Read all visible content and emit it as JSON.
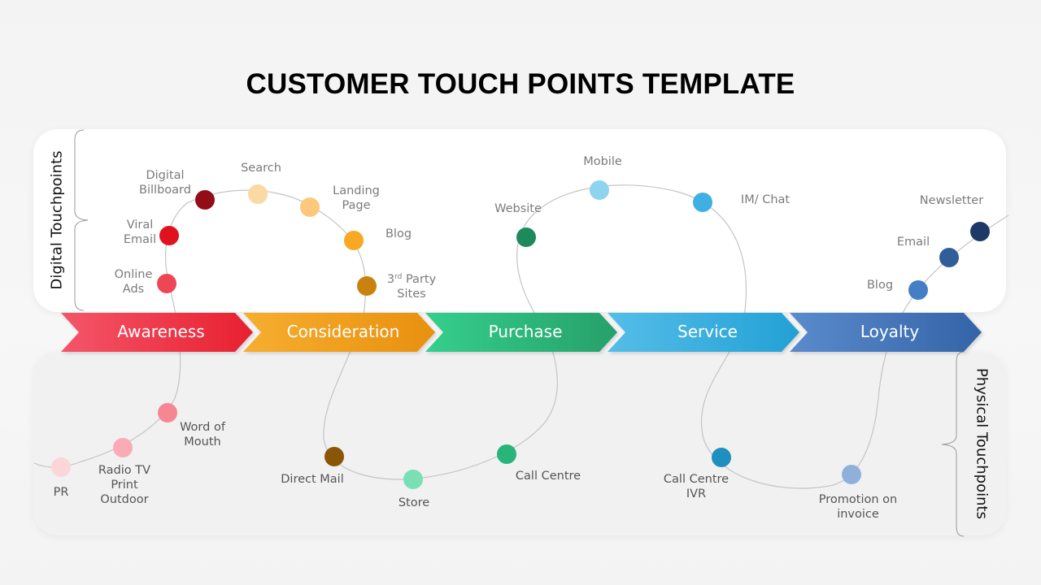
{
  "title": "CUSTOMER TOUCH POINTS TEMPLATE",
  "sections": {
    "digital_label": "Digital Touchpoints",
    "physical_label": "Physical Touchpoints"
  },
  "stages": [
    {
      "label": "Awareness",
      "color_start": "#f4566a",
      "color_end": "#e8202f"
    },
    {
      "label": "Consideration",
      "color_start": "#f6ae2f",
      "color_end": "#e9900f"
    },
    {
      "label": "Purchase",
      "color_start": "#35cf8c",
      "color_end": "#26a06a"
    },
    {
      "label": "Service",
      "color_start": "#55bde8",
      "color_end": "#22a1d5"
    },
    {
      "label": "Loyalty",
      "color_start": "#5a8bcc",
      "color_end": "#3464a8"
    }
  ],
  "digital_touchpoints": [
    {
      "label": "Online Ads",
      "lines": [
        "Online",
        "Ads"
      ],
      "color": "#ee4655",
      "stage": "Awareness"
    },
    {
      "label": "Viral Email",
      "lines": [
        "Viral",
        "Email"
      ],
      "color": "#e0121f",
      "stage": "Awareness"
    },
    {
      "label": "Digital Billboard",
      "lines": [
        "Digital",
        "Billboard"
      ],
      "color": "#930d16",
      "stage": "Awareness"
    },
    {
      "label": "Search",
      "lines": [
        "Search"
      ],
      "color": "#fbd9a2",
      "stage": "Consideration"
    },
    {
      "label": "Landing Page",
      "lines": [
        "Landing",
        "Page"
      ],
      "color": "#fcc87c",
      "stage": "Consideration"
    },
    {
      "label": "Blog",
      "lines": [
        "Blog"
      ],
      "color": "#f8a822",
      "stage": "Consideration"
    },
    {
      "label": "3rd Party Sites",
      "lines": [
        "3rd Party",
        "Sites"
      ],
      "color": "#c98210",
      "stage": "Consideration"
    },
    {
      "label": "Website",
      "lines": [
        "Website"
      ],
      "color": "#1e8a5c",
      "stage": "Purchase"
    },
    {
      "label": "Mobile",
      "lines": [
        "Mobile"
      ],
      "color": "#8fd4ee",
      "stage": "Service"
    },
    {
      "label": "IM/ Chat",
      "lines": [
        "IM/ Chat"
      ],
      "color": "#3fb0e2",
      "stage": "Service"
    },
    {
      "label": "Blog",
      "lines": [
        "Blog"
      ],
      "color": "#447fc6",
      "stage": "Loyalty"
    },
    {
      "label": "Email",
      "lines": [
        "Email"
      ],
      "color": "#2f5e9a",
      "stage": "Loyalty"
    },
    {
      "label": "Newsletter",
      "lines": [
        "Newsletter"
      ],
      "color": "#1d3a66",
      "stage": "Loyalty"
    }
  ],
  "physical_touchpoints": [
    {
      "label": "PR",
      "lines": [
        "PR"
      ],
      "color": "#fcd5d9",
      "stage": "Awareness"
    },
    {
      "label": "Radio TV Print Outdoor",
      "lines": [
        "Radio TV",
        "Print",
        "Outdoor"
      ],
      "color": "#f9acb6",
      "stage": "Awareness"
    },
    {
      "label": "Word of Mouth",
      "lines": [
        "Word of",
        "Mouth"
      ],
      "color": "#f58692",
      "stage": "Awareness"
    },
    {
      "label": "Direct Mail",
      "lines": [
        "Direct Mail"
      ],
      "color": "#8a5506",
      "stage": "Consideration"
    },
    {
      "label": "Store",
      "lines": [
        "Store"
      ],
      "color": "#7bdfb6",
      "stage": "Purchase"
    },
    {
      "label": "Call Centre",
      "lines": [
        "Call Centre"
      ],
      "color": "#27b57a",
      "stage": "Purchase"
    },
    {
      "label": "Call Centre IVR",
      "lines": [
        "Call Centre",
        "IVR"
      ],
      "color": "#1e8fbf",
      "stage": "Service"
    },
    {
      "label": "Promotion on invoice",
      "lines": [
        "Promotion on",
        "invoice"
      ],
      "color": "#90b0dc",
      "stage": "Loyalty"
    }
  ]
}
